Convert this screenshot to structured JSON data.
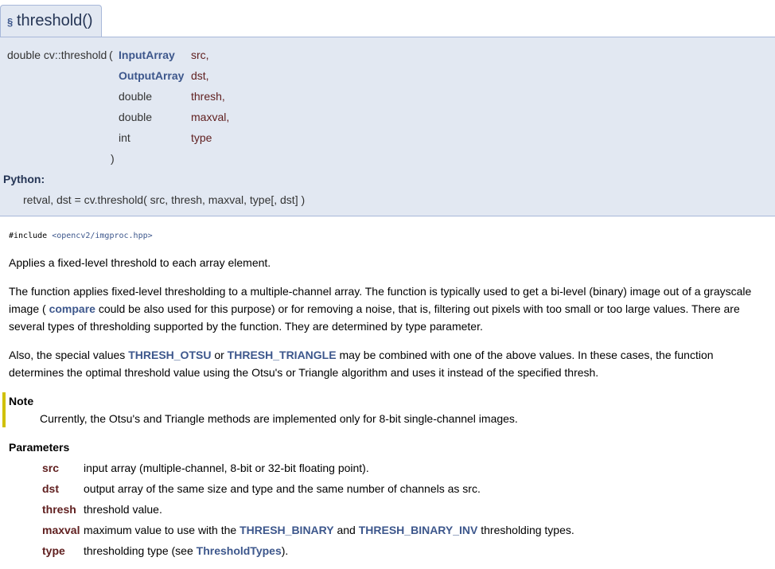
{
  "title": {
    "section_sign": "§",
    "name": "threshold()"
  },
  "prototype": {
    "return_and_name": "double cv::threshold",
    "open_paren": "(",
    "close_paren": ")",
    "params": [
      {
        "type": "InputArray",
        "name": "src,"
      },
      {
        "type": "OutputArray",
        "name": "dst,"
      },
      {
        "type": "double",
        "name": "thresh,"
      },
      {
        "type": "double",
        "name": "maxval,"
      },
      {
        "type": "int",
        "name": "type"
      }
    ]
  },
  "python": {
    "label": "Python:",
    "signature": "retval, dst = cv.threshold( src, thresh, maxval, type[, dst] )"
  },
  "include": {
    "directive": "#include",
    "header": "<opencv2/imgproc.hpp>"
  },
  "brief": "Applies a fixed-level threshold to each array element.",
  "details": {
    "p1_a": "The function applies fixed-level thresholding to a multiple-channel array. The function is typically used to get a bi-level (binary) image out of a grayscale image ( ",
    "p1_link": "compare",
    "p1_b": " could be also used for this purpose) or for removing a noise, that is, filtering out pixels with too small or too large values. There are several types of thresholding supported by the function. They are determined by type parameter.",
    "p2_a": "Also, the special values ",
    "p2_link1": "THRESH_OTSU",
    "p2_b": " or ",
    "p2_link2": "THRESH_TRIANGLE",
    "p2_c": " may be combined with one of the above values. In these cases, the function determines the optimal threshold value using the Otsu's or Triangle algorithm and uses it instead of the specified thresh."
  },
  "note": {
    "title": "Note",
    "text": "Currently, the Otsu's and Triangle methods are implemented only for 8-bit single-channel images."
  },
  "parameters": {
    "title": "Parameters",
    "items": [
      {
        "name": "src",
        "desc": "input array (multiple-channel, 8-bit or 32-bit floating point)."
      },
      {
        "name": "dst",
        "desc": "output array of the same size and type and the same number of channels as src."
      },
      {
        "name": "thresh",
        "desc": "threshold value."
      },
      {
        "name": "maxval",
        "desc_a": "maximum value to use with the ",
        "link1": "THRESH_BINARY",
        "desc_b": " and ",
        "link2": "THRESH_BINARY_INV",
        "desc_c": " thresholding types."
      },
      {
        "name": "type",
        "desc_a": "thresholding type (see ",
        "link1": "ThresholdTypes",
        "desc_b": ")."
      }
    ]
  },
  "colors": {
    "header_bg": "#e2e8f2",
    "border": "#a8b8d9",
    "link": "#3d578c",
    "param_name": "#602020",
    "note_bar": "#d0c000"
  }
}
